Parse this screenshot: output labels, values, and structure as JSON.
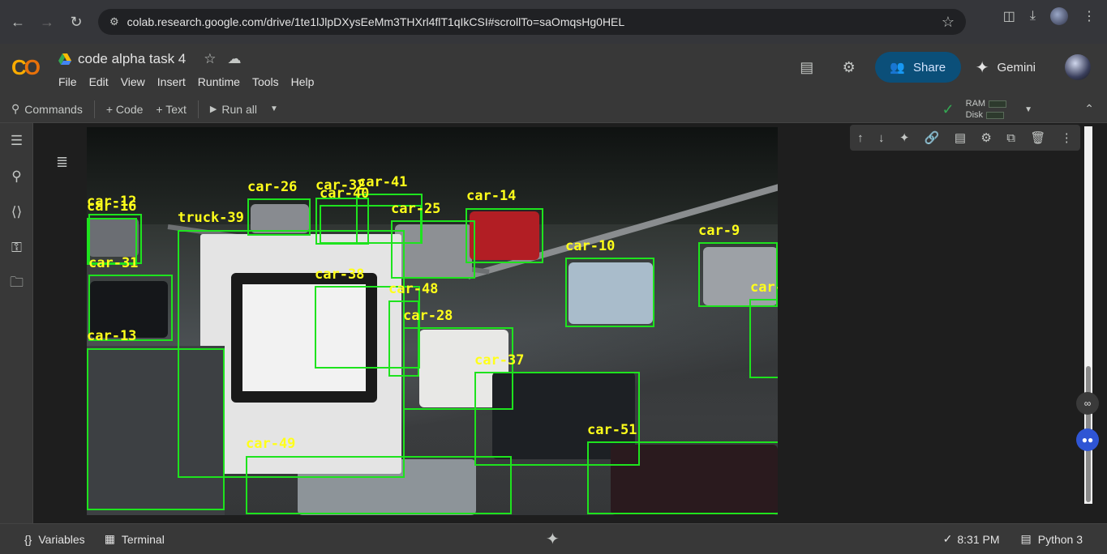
{
  "browser": {
    "url": "colab.research.google.com/drive/1te1lJlpDXysEeMm3THXrl4flT1qIkCSI#scrollTo=saOmqsHg0HEL"
  },
  "notebook": {
    "title": "code alpha task 4",
    "menu": [
      "File",
      "Edit",
      "View",
      "Insert",
      "Runtime",
      "Tools",
      "Help"
    ],
    "share_label": "Share",
    "gemini_label": "Gemini"
  },
  "toolbar": {
    "commands": "Commands",
    "code": "+ Code",
    "text": "+ Text",
    "run_all": "Run all",
    "ram": "RAM",
    "disk": "Disk"
  },
  "detections": [
    {
      "label": "car-12"
    },
    {
      "label": "car-16"
    },
    {
      "label": "car-31"
    },
    {
      "label": "car-13"
    },
    {
      "label": "truck-39"
    },
    {
      "label": "car-26"
    },
    {
      "label": "car-32"
    },
    {
      "label": "car-41"
    },
    {
      "label": "car-40"
    },
    {
      "label": "car-25"
    },
    {
      "label": "car-14"
    },
    {
      "label": "car-38"
    },
    {
      "label": "car-48"
    },
    {
      "label": "car-28"
    },
    {
      "label": "car-37"
    },
    {
      "label": "car-10"
    },
    {
      "label": "car-9"
    },
    {
      "label": "car-"
    },
    {
      "label": "car-51"
    },
    {
      "label": "car-49"
    }
  ],
  "status": {
    "variables": "Variables",
    "terminal": "Terminal",
    "time": "8:31 PM",
    "runtime": "Python 3"
  },
  "colors": {
    "box": "#1ee31e",
    "label": "#ffff1a",
    "share_bg": "#0b4f79"
  }
}
